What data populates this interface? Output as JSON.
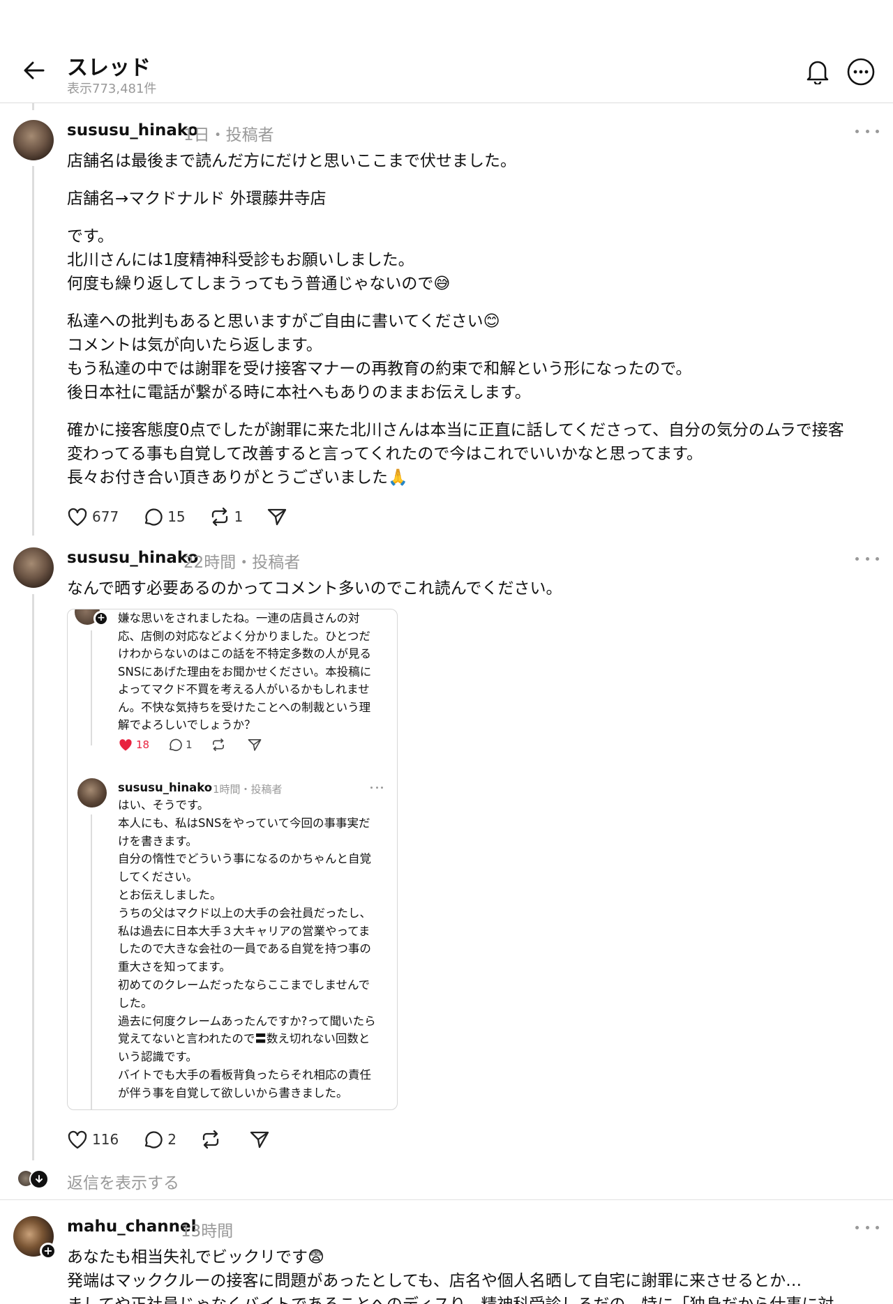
{
  "header": {
    "title": "スレッド",
    "subtitle": "表示773,481件"
  },
  "posts": [
    {
      "username": "sususu_hinako",
      "meta": "1日・投稿者",
      "paragraphs": [
        [
          "店舗名は最後まで読んだ方にだけと思いここまで伏せました。"
        ],
        [
          "店舗名→マクドナルド 外環藤井寺店"
        ],
        [
          "です。",
          "北川さんには1度精神科受診もお願いしました。",
          "何度も繰り返してしまうってもう普通じゃないので😅"
        ],
        [
          "私達への批判もあると思いますがご自由に書いてください😊",
          "コメントは気が向いたら返します。",
          "もう私達の中では謝罪を受け接客マナーの再教育の約束で和解という形になったので。",
          "後日本社に電話が繋がる時に本社へもありのままお伝えします。"
        ],
        [
          "確かに接客態度0点でしたが謝罪に来た北川さんは本当に正直に話してくださって、自分の気分のムラで接客",
          "変わってる事も自覚して改善すると言ってくれたので今はこれでいいかなと思ってます。",
          "長々お付き合い頂きありがとうございました🙏"
        ]
      ],
      "likes": "677",
      "comments": "15",
      "reposts": "1"
    },
    {
      "username": "sususu_hinako",
      "meta": "22時間・投稿者",
      "text": "なんで晒す必要あるのかってコメント多いのでこれ読んでください。",
      "embed": {
        "reply_lines": [
          "嫌な思いをされましたね。一連の店員さんの対",
          "応、店側の対応などよく分かりました。ひとつだ",
          "けわからないのはこの話を不特定多数の人が見る",
          "SNSにあげた理由をお聞かせください。本投稿に",
          "よってマクド不買を考える人がいるかもしれませ",
          "ん。不快な気持ちを受けたことへの制裁という理",
          "解でよろしいでしょうか？"
        ],
        "reply_likes": "18",
        "reply_comments": "1",
        "author": "sususu_hinako",
        "author_meta": "1時間・投稿者",
        "answer_lines": [
          "はい、そうです。",
          "本人にも、私はSNSをやっていて今回の事事実だ",
          "けを書きます。",
          "自分の惰性でどういう事になるのかちゃんと自覚",
          "してください。",
          "とお伝えしました。",
          "うちの父はマクド以上の大手の会社員だったし、",
          "私は過去に日本大手３大キャリアの営業やってま",
          "したので大きな会社の一員である自覚を持つ事の",
          "重大さを知ってます。",
          "初めてのクレームだったならここまでしませんで",
          "した。",
          "過去に何度クレームあったんですか?って聞いたら",
          "覚えてないと言われたので〓数え切れない回数と",
          "いう認識です。",
          "バイトでも大手の看板背負ったらそれ相応の責任",
          "が伴う事を自覚して欲しいから書きました。"
        ]
      },
      "likes": "116",
      "comments": "2"
    }
  ],
  "show_replies": "返信を表示する",
  "third_post": {
    "username": "mahu_channel",
    "meta": "13時間",
    "lines": [
      "あなたも相当失礼でビックリです😨",
      "発端はマッククルーの接客に問題があったとしても、店名や個人名晒して自宅に謝罪に来させるとか…",
      "ましてや正社員じゃなくバイトであることへのディスり、精神科受診しろだの、特に「独身だから仕事に対"
    ]
  }
}
